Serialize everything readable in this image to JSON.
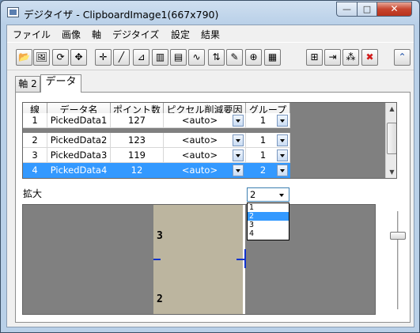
{
  "window": {
    "title": "デジタイザ - ClipboardImage1(667x790)",
    "minimize_glyph": "—",
    "maximize_glyph": "□",
    "close_glyph": "✕"
  },
  "menu": [
    "ファイル",
    "画像",
    "軸",
    "デジタイズ",
    "設定",
    "結果"
  ],
  "toolbar": {
    "buttons": [
      {
        "name": "open-folder-icon",
        "glyph": "📂"
      },
      {
        "name": "import-image-icon",
        "glyph": "🖼"
      },
      {
        "name": "rotate-image-icon",
        "glyph": "⟳"
      },
      {
        "name": "move-axes-icon",
        "glyph": "✥"
      },
      {
        "name": "pick-point-icon",
        "glyph": "✛"
      },
      {
        "name": "line-digitize-icon",
        "glyph": "╱"
      },
      {
        "name": "edge-digitize-icon",
        "glyph": "⊿"
      },
      {
        "name": "bar-digitize-icon",
        "glyph": "▥"
      },
      {
        "name": "area-digitize-icon",
        "glyph": "▤"
      },
      {
        "name": "curve-digitize-icon",
        "glyph": "∿"
      },
      {
        "name": "sort-icon",
        "glyph": "⇅"
      },
      {
        "name": "select-tool-icon",
        "glyph": "✎"
      },
      {
        "name": "add-point-icon",
        "glyph": "⊕"
      },
      {
        "name": "delete-points-icon",
        "glyph": "▦"
      },
      {
        "name": "add-column-icon",
        "glyph": "⊞"
      },
      {
        "name": "insert-column-icon",
        "glyph": "⇥"
      },
      {
        "name": "add-dataset-icon",
        "glyph": "⁂"
      },
      {
        "name": "delete-icon",
        "glyph": "✖"
      },
      {
        "name": "collapse-icon",
        "glyph": "⌃"
      }
    ]
  },
  "tabs": [
    {
      "label": "軸 2",
      "active": false
    },
    {
      "label": "データ",
      "active": true
    }
  ],
  "table": {
    "headers": [
      "線",
      "データ名",
      "ポイント数",
      "ピクセル削減要因",
      "グループ"
    ],
    "rows": [
      {
        "line": "1",
        "name": "PickedData1",
        "count": "127",
        "factor": "<auto>",
        "group": "1",
        "selected": false
      },
      {
        "line": "2",
        "name": "PickedData2",
        "count": "123",
        "factor": "<auto>",
        "group": "1",
        "selected": false
      },
      {
        "line": "3",
        "name": "PickedData3",
        "count": "119",
        "factor": "<auto>",
        "group": "1",
        "selected": false
      },
      {
        "line": "4",
        "name": "PickedData4",
        "count": "12",
        "factor": "<auto>",
        "group": "2",
        "selected": true
      }
    ]
  },
  "group_dropdown": {
    "value": "2",
    "options": [
      "1",
      "2",
      "3",
      "4"
    ],
    "highlighted": "2"
  },
  "zoom": {
    "label": "拡大",
    "digits": [
      "3",
      "2"
    ]
  },
  "colors": {
    "selection": "#3399ff",
    "crosshair": "#1133cc",
    "close_button": "#c7452f"
  }
}
